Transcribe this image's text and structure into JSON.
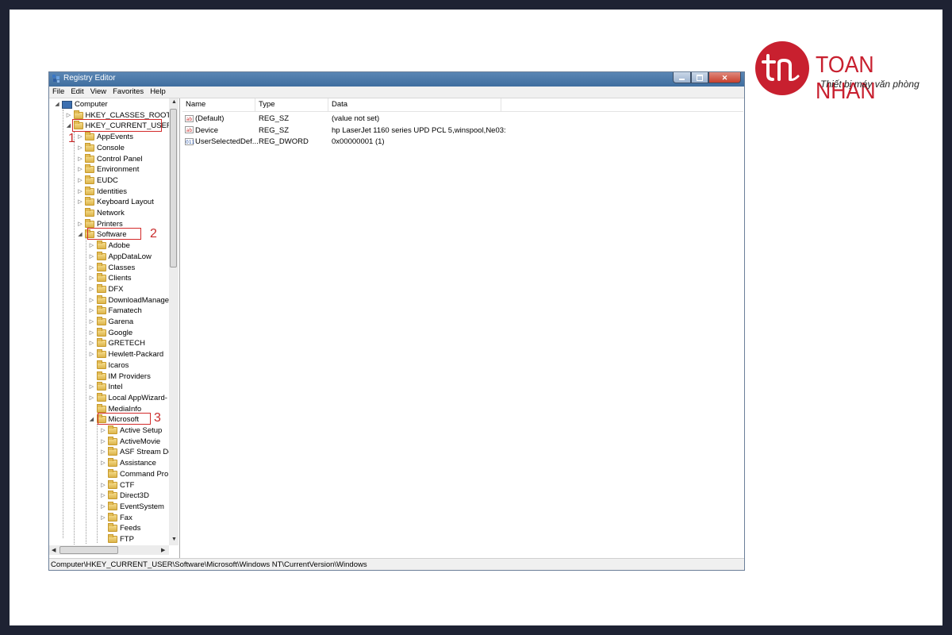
{
  "logo": {
    "mark": "tn",
    "name": "TOAN NHAN",
    "tagline": "Thiết bị máy văn phòng",
    "brand_color": "#c8202f"
  },
  "window": {
    "title": "Registry Editor",
    "icon": "registry-editor-icon",
    "menu": [
      "File",
      "Edit",
      "View",
      "Favorites",
      "Help"
    ]
  },
  "tree": {
    "root": "Computer",
    "hives": [
      "HKEY_CLASSES_ROOT",
      "HKEY_CURRENT_USER"
    ],
    "hkcu_children": [
      "AppEvents",
      "Console",
      "Control Panel",
      "Environment",
      "EUDC",
      "Identities",
      "Keyboard Layout",
      "Network",
      "Printers",
      "Software"
    ],
    "software_children": [
      "Adobe",
      "AppDataLow",
      "Classes",
      "Clients",
      "DFX",
      "DownloadManage",
      "Famatech",
      "Garena",
      "Google",
      "GRETECH",
      "Hewlett-Packard",
      "Icaros",
      "IM Providers",
      "Intel",
      "Local AppWizard-",
      "MediaInfo",
      "Microsoft"
    ],
    "microsoft_children": [
      "Active Setup",
      "ActiveMovie",
      "ASF Stream De",
      "Assistance",
      "Command Pro",
      "CTF",
      "Direct3D",
      "EventSystem",
      "Fax",
      "Feeds",
      "FTP"
    ]
  },
  "annotations": [
    "1",
    "2",
    "3"
  ],
  "list": {
    "columns": [
      "Name",
      "Type",
      "Data"
    ],
    "rows": [
      {
        "icon": "ab",
        "name": "(Default)",
        "type": "REG_SZ",
        "data": "(value not set)"
      },
      {
        "icon": "ab",
        "name": "Device",
        "type": "REG_SZ",
        "data": "hp LaserJet 1160 series UPD PCL 5,winspool,Ne03:"
      },
      {
        "icon": "bin",
        "name": "UserSelectedDef...",
        "type": "REG_DWORD",
        "data": "0x00000001 (1)"
      }
    ]
  },
  "status": "Computer\\HKEY_CURRENT_USER\\Software\\Microsoft\\Windows NT\\CurrentVersion\\Windows"
}
